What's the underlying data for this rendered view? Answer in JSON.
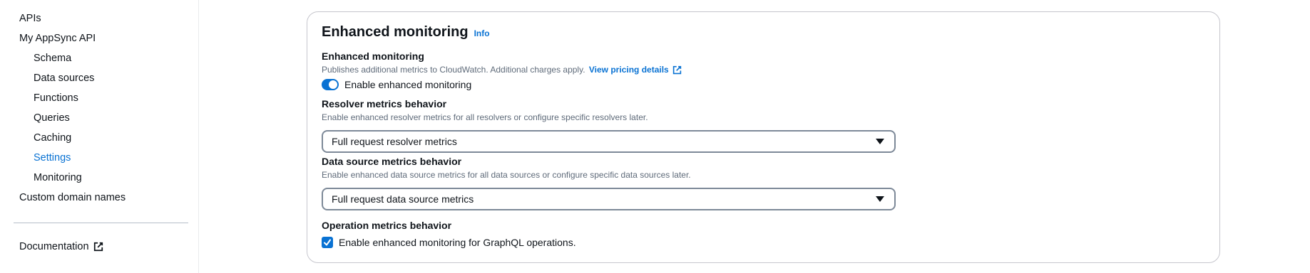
{
  "sidebar": {
    "items": [
      {
        "label": "APIs"
      },
      {
        "label": "My AppSync API"
      },
      {
        "label": "Schema"
      },
      {
        "label": "Data sources"
      },
      {
        "label": "Functions"
      },
      {
        "label": "Queries"
      },
      {
        "label": "Caching"
      },
      {
        "label": "Settings",
        "active": true
      },
      {
        "label": "Monitoring"
      },
      {
        "label": "Custom domain names"
      }
    ],
    "documentation": "Documentation"
  },
  "card": {
    "title": "Enhanced monitoring",
    "info": "Info",
    "monitoring": {
      "label": "Enhanced monitoring",
      "description": "Publishes additional metrics to CloudWatch. Additional charges apply.",
      "link": "View pricing details",
      "toggle_label": "Enable enhanced monitoring",
      "toggle_on": true
    },
    "resolver": {
      "label": "Resolver metrics behavior",
      "description": "Enable enhanced resolver metrics for all resolvers or configure specific resolvers later.",
      "value": "Full request resolver metrics"
    },
    "datasource": {
      "label": "Data source metrics behavior",
      "description": "Enable enhanced data source metrics for all data sources or configure specific data sources later.",
      "value": "Full request data source metrics"
    },
    "operation": {
      "label": "Operation metrics behavior",
      "checkbox_label": "Enable enhanced monitoring for GraphQL operations.",
      "checked": true
    }
  },
  "colors": {
    "accent": "#0972d3",
    "text": "#0f141a",
    "muted": "#5f6b7a",
    "border": "#c6c6cd"
  }
}
